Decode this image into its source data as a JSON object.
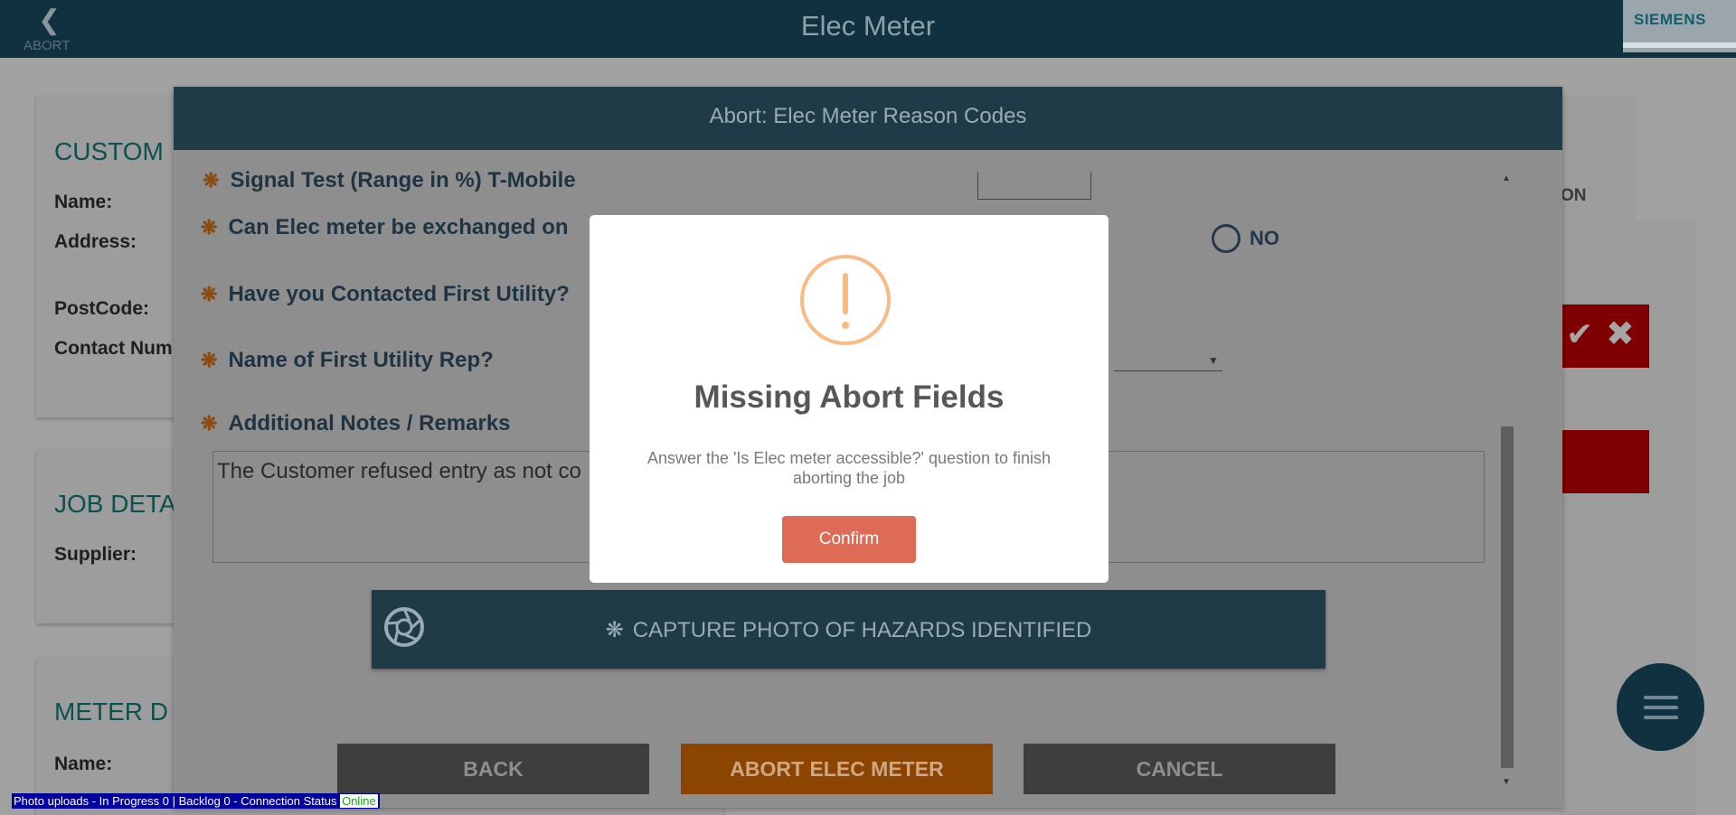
{
  "header": {
    "abort_label": "ABORT",
    "title": "Elec Meter",
    "brand": "SIEMENS"
  },
  "background": {
    "customer_card": {
      "title": "CUSTOM",
      "fields": [
        "Name:",
        "Address:",
        "PostCode:",
        "Contact Num"
      ]
    },
    "job_card": {
      "title": "JOB DETA",
      "fields": [
        "Supplier:"
      ]
    },
    "meter_card": {
      "title": "METER D",
      "fields": [
        "Name:"
      ]
    },
    "right_fragment": "ON"
  },
  "dialog": {
    "title": "Abort: Elec Meter Reason Codes",
    "questions": [
      "Signal Test (Range in %) T-Mobile",
      "Can Elec meter be exchanged on",
      "Have you Contacted First Utility?",
      "Name of First Utility Rep?",
      "Additional Notes / Remarks"
    ],
    "no_option": "NO",
    "notes_value": "The Customer refused entry as not co",
    "photo_button": "CAPTURE PHOTO OF HAZARDS IDENTIFIED",
    "back_button": "BACK",
    "abort_button": "ABORT ELEC METER",
    "cancel_button": "CANCEL"
  },
  "alert": {
    "title": "Missing Abort Fields",
    "message": "Answer the 'Is Elec meter accessible?' question to finish aborting the job",
    "confirm": "Confirm",
    "icon": "warning-icon",
    "icon_color": "#f8bb86",
    "confirm_color": "#dd6b55"
  },
  "status_bar": {
    "text": "Photo uploads - In Progress 0 | Backlog 0 - Connection Status",
    "connection": "Online"
  }
}
